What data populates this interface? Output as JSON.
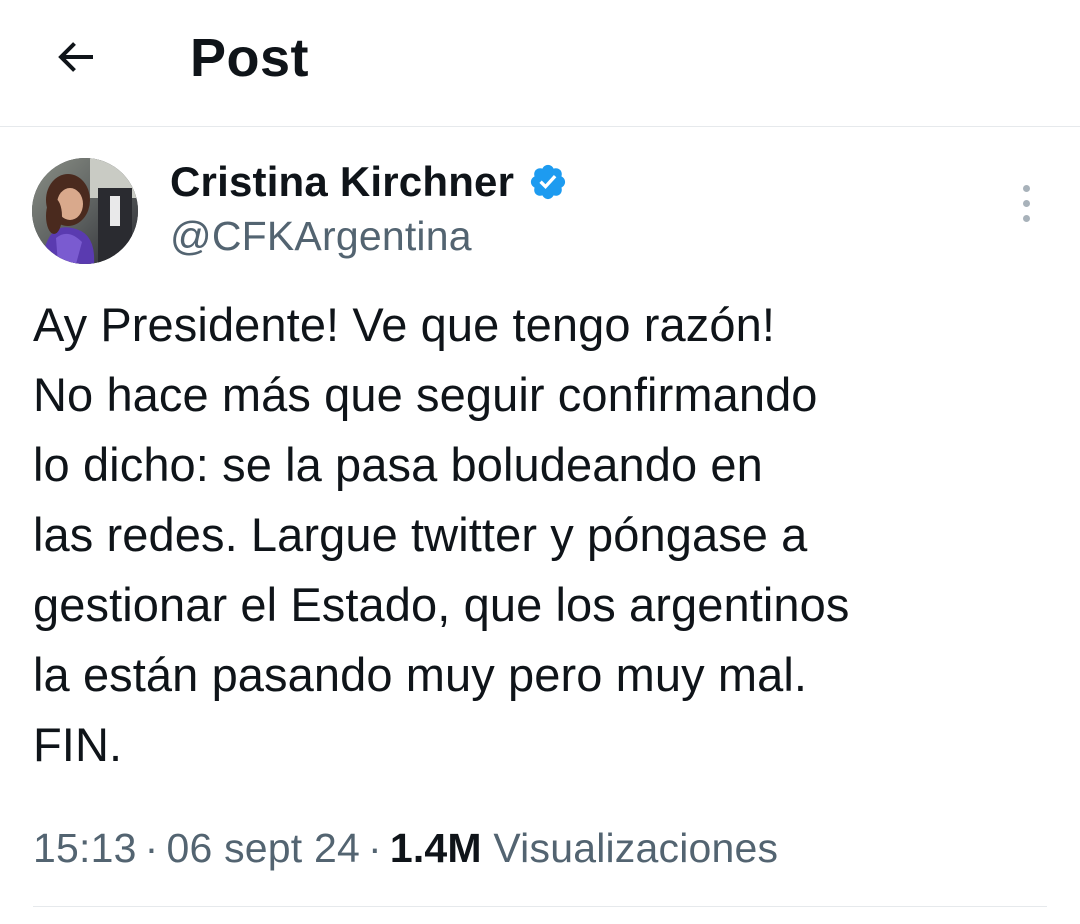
{
  "header": {
    "back_icon": "arrow-left-icon",
    "title": "Post"
  },
  "author": {
    "name": "Cristina Kirchner",
    "handle": "@CFKArgentina",
    "verified_icon": "verified-badge-icon",
    "verified_color": "#1d9bf0"
  },
  "more_icon": "more-vertical-icon",
  "tweet": {
    "lines": [
      "Ay Presidente! Ve que tengo razón!",
      "No hace más que seguir confirmando",
      "lo dicho: se la pasa boludeando en",
      "las redes. Largue twitter y póngase a",
      "gestionar el Estado, que los argentinos",
      "la están pasando muy pero muy mal.",
      "FIN."
    ]
  },
  "meta": {
    "time": "15:13",
    "date": "06 sept 24",
    "separator": "·",
    "views_count": "1.4M",
    "views_label": "Visualizaciones"
  }
}
